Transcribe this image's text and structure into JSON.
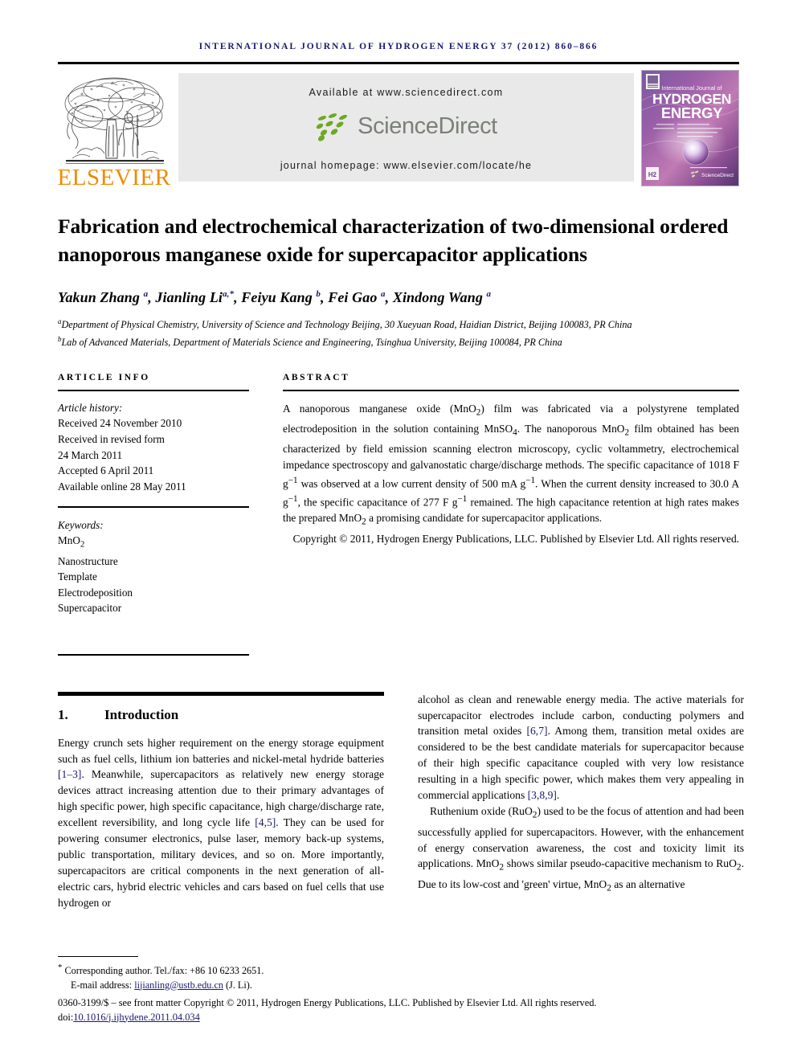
{
  "running_head": "International Journal of Hydrogen Energy 37 (2012) 860–866",
  "masthead": {
    "publisher_name": "ELSEVIER",
    "available_at": "Available at www.sciencedirect.com",
    "sciencedirect_word": "ScienceDirect",
    "journal_homepage": "journal homepage: www.elsevier.com/locate/he",
    "cover": {
      "line1": "International Journal of",
      "line2": "HYDROGEN",
      "line3": "ENERGY",
      "footer_brand": "ScienceDirect"
    },
    "colors": {
      "elsevier_orange": "#ED8B00",
      "sciencedirect_green": "#6FA824",
      "sciencedirect_gray": "#7b8079",
      "banner_bg": "#e9e9e9",
      "running_head_navy": "#191970"
    }
  },
  "article": {
    "title": "Fabrication and electrochemical characterization of two-dimensional ordered nanoporous manganese oxide for supercapacitor applications",
    "authors_html": "Yakun Zhang <sup>a</sup>, Jianling Li<sup>a,*</sup>, Feiyu Kang <sup>b</sup>, Fei Gao <sup>a</sup>, Xindong Wang <sup>a</sup>",
    "affiliation_a": "Department of Physical Chemistry, University of Science and Technology Beijing, 30 Xueyuan Road, Haidian District, Beijing 100083, PR China",
    "affiliation_b": "Lab of Advanced Materials, Department of Materials Science and Engineering, Tsinghua University, Beijing 100084, PR China",
    "affiliation_a_marker": "a",
    "affiliation_b_marker": "b"
  },
  "article_info": {
    "heading": "ARTICLE INFO",
    "history_label": "Article history:",
    "history": [
      "Received 24 November 2010",
      "Received in revised form",
      "24 March 2011",
      "Accepted 6 April 2011",
      "Available online 28 May 2011"
    ],
    "keywords_label": "Keywords:",
    "keywords_html": [
      "MnO<sub>2</sub>",
      "Nanostructure",
      "Template",
      "Electrodeposition",
      "Supercapacitor"
    ]
  },
  "abstract": {
    "heading": "ABSTRACT",
    "body_html": "A nanoporous manganese oxide (MnO<sub>2</sub>) film was fabricated via a polystyrene templated electrodeposition in the solution containing MnSO<sub>4</sub>. The nanoporous MnO<sub>2</sub> film obtained has been characterized by field emission scanning electron microscopy, cyclic voltammetry, electrochemical impedance spectroscopy and galvanostatic charge/discharge methods. The specific capacitance of 1018 F g<sup>−1</sup> was observed at a low current density of 500 mA g<sup>−1</sup>. When the current density increased to 30.0 A g<sup>−1</sup>, the specific capacitance of 277 F g<sup>−1</sup> remained. The high capacitance retention at high rates makes the prepared MnO<sub>2</sub> a promising candidate for supercapacitor applications.",
    "copyright_html": "Copyright © 2011, Hydrogen Energy Publications, LLC. Published by Elsevier Ltd. All rights reserved."
  },
  "introduction": {
    "number": "1.",
    "heading": "Introduction",
    "left_column_html": "Energy crunch sets higher requirement on the energy storage equipment such as fuel cells, lithium ion batteries and nickel-metal hydride batteries <span class=\"ref\">[1–3]</span>. Meanwhile, supercapacitors as relatively new energy storage devices attract increasing attention due to their primary advantages of high specific power, high specific capacitance, high charge/discharge rate, excellent reversibility, and long cycle life <span class=\"ref\">[4,5]</span>. They can be used for powering consumer electronics, pulse laser, memory back-up systems, public transportation, military devices, and so on. More importantly, supercapacitors are critical components in the next generation of all-electric cars, hybrid electric vehicles and cars based on fuel cells that use hydrogen or",
    "right_column_p1_html": "alcohol as clean and renewable energy media. The active materials for supercapacitor electrodes include carbon, conducting polymers and transition metal oxides <span class=\"ref\">[6,7]</span>. Among them, transition metal oxides are considered to be the best candidate materials for supercapacitor because of their high specific capacitance coupled with very low resistance resulting in a high specific power, which makes them very appealing in commercial applications <span class=\"ref\">[3,8,9]</span>.",
    "right_column_p2_html": "Ruthenium oxide (RuO<sub>2</sub>) used to be the focus of attention and had been successfully applied for supercapacitors. However, with the enhancement of energy conservation awareness, the cost and toxicity limit its applications. MnO<sub>2</sub> shows similar pseudo-capacitive mechanism to RuO<sub>2</sub>. Due to its low-cost and 'green' virtue, MnO<sub>2</sub> as an alternative"
  },
  "footnote": {
    "corresponding_html": "<span class=\"fn-star\">*</span> Corresponding author. Tel./fax: +86 10 6233 2651.",
    "email_label": "E-mail address:",
    "email": "lijianling@ustb.edu.cn",
    "email_suffix": "(J. Li).",
    "issn_line_html": "0360-3199/$ – see front matter Copyright © 2011, Hydrogen Energy Publications, LLC. Published by Elsevier Ltd. All rights reserved.",
    "doi_prefix": "doi:",
    "doi": "10.1016/j.ijhydene.2011.04.034"
  }
}
